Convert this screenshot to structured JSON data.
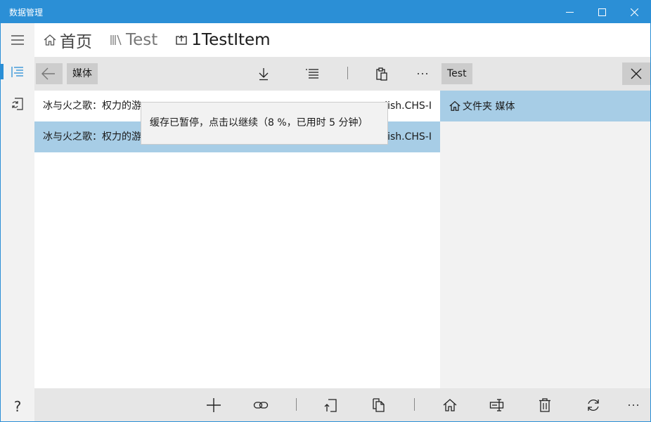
{
  "window": {
    "title": "数据管理",
    "controls": [
      "minimize-icon",
      "maximize-icon",
      "close-icon"
    ]
  },
  "rail": {
    "items": [
      "hamburger-menu-icon",
      "list-view-icon",
      "sync-icon"
    ],
    "help_label": "?",
    "selected": "list-view-icon"
  },
  "breadcrumb": {
    "items": [
      {
        "label": "首页",
        "icon": "home-icon"
      },
      {
        "label": "Test",
        "icon": "library-icon"
      },
      {
        "label": "1TestItem",
        "icon": "open-item-icon"
      }
    ]
  },
  "toolbar": {
    "location": "媒体",
    "icons": [
      "back-arrow-icon",
      "download-icon",
      "list-icon",
      "clipboard-icon",
      "more-icon"
    ]
  },
  "list": {
    "rows": [
      {
        "start": "冰与火之歌：权力的游",
        "end": "lish.CHS-I",
        "selected": false
      },
      {
        "start": "冰与火之歌：权力的游",
        "end": "lish.CHS-I",
        "selected": true
      }
    ]
  },
  "tooltip": {
    "text": "缓存已暂停，点击以继续（8 %，已用时 5 分钟）"
  },
  "right_panel": {
    "tag": "Test",
    "item_label": "文件夹 媒体",
    "icons": [
      "close-icon",
      "home-icon"
    ]
  },
  "bottom_bar": {
    "icons": [
      "add-icon",
      "link-icon",
      "import-icon",
      "copy-icon",
      "home-icon",
      "rename-icon",
      "delete-icon",
      "refresh-icon",
      "more-icon"
    ]
  },
  "colors": {
    "accent": "#2b8fd6",
    "selection": "#a7cde6",
    "toolbar_bg": "#e6e6e6",
    "chip_bg": "#cccccc",
    "panel_bg": "#f2f2f2"
  }
}
